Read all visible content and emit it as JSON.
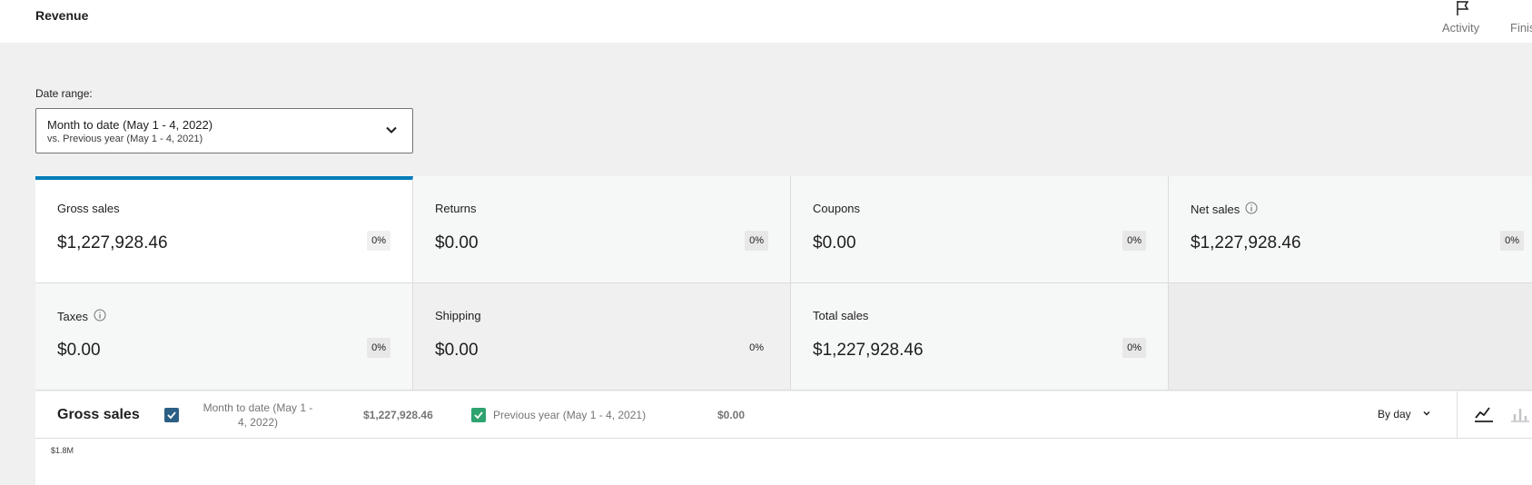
{
  "header": {
    "title": "Revenue",
    "actions": [
      {
        "label": "Activity",
        "icon": "flag-icon"
      },
      {
        "label": "Finis"
      }
    ]
  },
  "date_range": {
    "label": "Date range:",
    "main": "Month to date (May 1 - 4, 2022)",
    "comparison": "vs. Previous year (May 1 - 4, 2021)"
  },
  "tiles": [
    {
      "label": "Gross sales",
      "value": "$1,227,928.46",
      "delta": "0%",
      "selected": true
    },
    {
      "label": "Returns",
      "value": "$0.00",
      "delta": "0%"
    },
    {
      "label": "Coupons",
      "value": "$0.00",
      "delta": "0%"
    },
    {
      "label": "Net sales",
      "value": "$1,227,928.46",
      "delta": "0%",
      "info": true
    },
    {
      "label": "Taxes",
      "value": "$0.00",
      "delta": "0%",
      "info": true
    },
    {
      "label": "Shipping",
      "value": "$0.00",
      "delta": "0%"
    },
    {
      "label": "Total sales",
      "value": "$1,227,928.46",
      "delta": "0%"
    }
  ],
  "chart": {
    "title": "Gross sales",
    "legend": [
      {
        "label": "Month to date (May 1 - 4, 2022)",
        "value": "$1,227,928.46",
        "color": "#2c5f84",
        "checked": true
      },
      {
        "label": "Previous year (May 1 - 4, 2021)",
        "value": "$0.00",
        "color": "#2ea36f",
        "checked": true
      }
    ],
    "interval": "By day",
    "y_tick": "$1.8M"
  },
  "colors": {
    "accent": "#007cba",
    "background": "#f0f0f1"
  }
}
